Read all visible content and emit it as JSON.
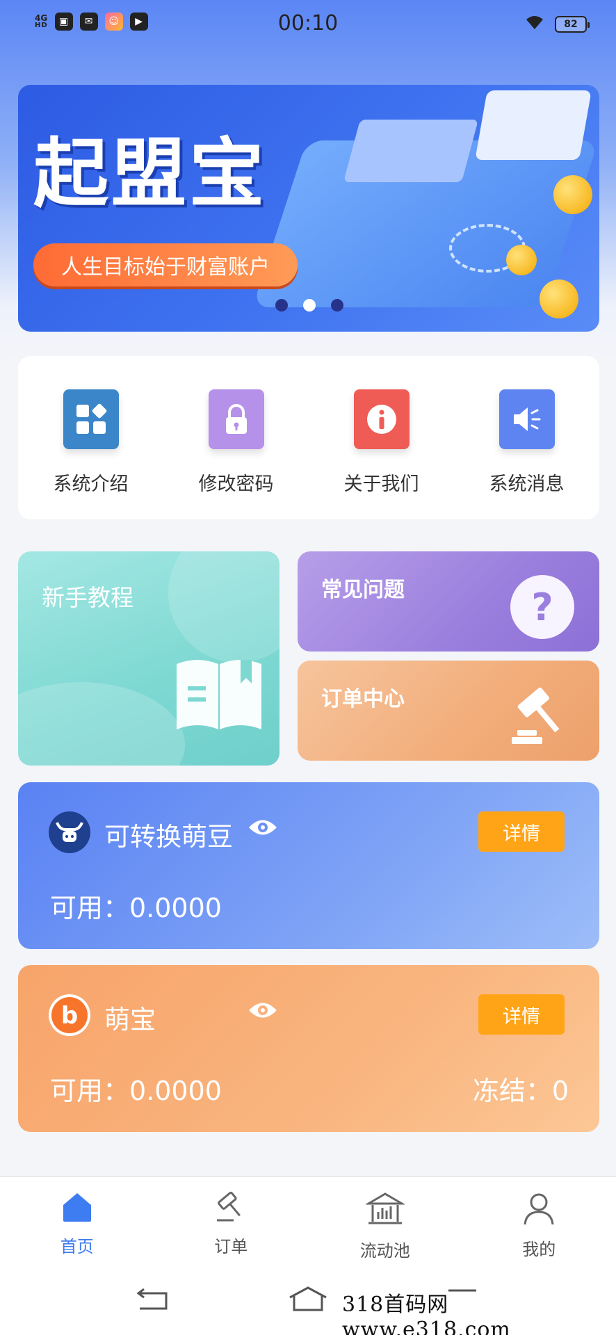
{
  "status_bar": {
    "network": "4G",
    "network_sub": "HD",
    "time": "00:10",
    "battery": "82"
  },
  "banner": {
    "title": "起盟宝",
    "slogan": "人生目标始于财富账户",
    "dots_total": 3,
    "dots_active_index": 1
  },
  "quick_menu": {
    "items": [
      {
        "label": "系统介绍",
        "icon": "grid-apps-icon",
        "color": "#3a86c9"
      },
      {
        "label": "修改密码",
        "icon": "lock-icon",
        "color": "#b691ea"
      },
      {
        "label": "关于我们",
        "icon": "info-icon",
        "color": "#ef5b55"
      },
      {
        "label": "系统消息",
        "icon": "speaker-icon",
        "color": "#5d84f0"
      }
    ]
  },
  "features": {
    "tutorial_title": "新手教程",
    "faq_title": "常见问题",
    "orders_title": "订单中心"
  },
  "wallets": {
    "beans": {
      "name": "可转换萌豆",
      "detail_label": "详情",
      "available": "可用：0.0000"
    },
    "mengbao": {
      "name": "萌宝",
      "detail_label": "详情",
      "available": "可用：0.0000",
      "frozen": "冻结：0"
    }
  },
  "bottom_nav": {
    "active_index": 0,
    "items": [
      {
        "label": "首页",
        "icon": "home-icon"
      },
      {
        "label": "订单",
        "icon": "gavel-icon"
      },
      {
        "label": "流动池",
        "icon": "bank-icon"
      },
      {
        "label": "我的",
        "icon": "user-icon"
      }
    ]
  },
  "colors": {
    "accent": "#3d7cf1",
    "detail_button": "#ffa417"
  },
  "watermark": "318首码网 www.e318.com"
}
